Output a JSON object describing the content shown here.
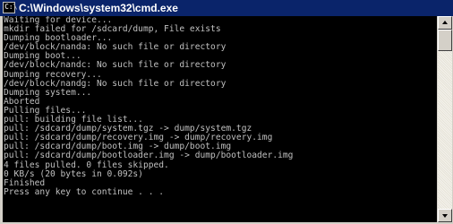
{
  "window": {
    "title": "C:\\Windows\\system32\\cmd.exe",
    "icon": "cmd-icon",
    "icon_glyph": "C:\\"
  },
  "console": {
    "text": "Waiting for device...\nmkdir failed for /sdcard/dump, File exists\nDumping bootloader...\n/dev/block/nanda: No such file or directory\nDumping boot...\n/dev/block/nandc: No such file or directory\nDumping recovery...\n/dev/block/nandg: No such file or directory\nDumping system...\nAborted\nPulling files...\npull: building file list...\npull: /sdcard/dump/system.tgz -> dump/system.tgz\npull: /sdcard/dump/recovery.img -> dump/recovery.img\npull: /sdcard/dump/boot.img -> dump/boot.img\npull: /sdcard/dump/bootloader.img -> dump/bootloader.img\n4 files pulled. 0 files skipped.\n0 KB/s (20 bytes in 0.092s)\nFinished\nPress any key to continue . . ."
  },
  "colors": {
    "titlebar": "#0a246a",
    "console_bg": "#000000",
    "console_fg": "#c0c0c0"
  },
  "scrollbar": {
    "up_icon": "arrow-up-icon",
    "down_icon": "arrow-down-icon"
  }
}
